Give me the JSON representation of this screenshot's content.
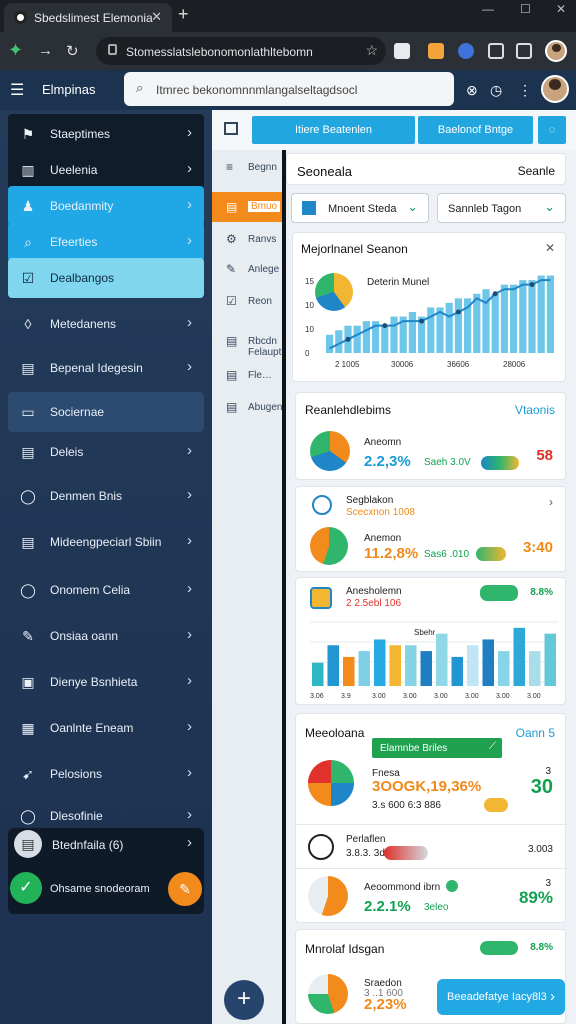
{
  "browser": {
    "tab_title": "Sbedslimest Elemonia",
    "url": "Stomesslatslebonomonlathltebomn",
    "controls": {
      "min": "—",
      "max": "☐",
      "close": "✕"
    }
  },
  "app": {
    "title": "Elmpinas",
    "search": "Itmrec bekonomnnmlangalseltagdsocl"
  },
  "sidebar": {
    "items": [
      {
        "label": "Staeptimes",
        "icon": "flag-icon"
      },
      {
        "label": "Ueelenia",
        "icon": "chart-icon"
      },
      {
        "label": "Boedanmity",
        "icon": "people-icon"
      },
      {
        "label": "Efeerties",
        "icon": "search-icon"
      },
      {
        "label": "Dealbangos",
        "icon": "check-icon"
      },
      {
        "label": "Metedanens",
        "icon": "leaf-icon"
      },
      {
        "label": "Bepenal Idegesin",
        "icon": "doc-icon"
      },
      {
        "label": "Sociernae",
        "icon": "list-icon"
      },
      {
        "label": "Deleis",
        "icon": "doc-icon"
      },
      {
        "label": "Denmen Bnis",
        "icon": "target-icon"
      },
      {
        "label": "Mideengpeciarl Sbiin",
        "icon": "doc-icon"
      },
      {
        "label": "Onomem Celia",
        "icon": "target-icon"
      },
      {
        "label": "Onsiaa oann",
        "icon": "edit-icon"
      },
      {
        "label": "Dienye Bsnhieta",
        "icon": "calendar-icon"
      },
      {
        "label": "Oanlnte Eneam",
        "icon": "grid-icon"
      },
      {
        "label": "Pelosions",
        "icon": "rocket-icon"
      },
      {
        "label": "Dlesofinie",
        "icon": "target-icon"
      },
      {
        "label": "Btednfaila (6)",
        "icon": "doc-icon"
      }
    ],
    "footer": "Ohsame snodeoram"
  },
  "toolbar": {
    "btn1": "Itiere Beatenlen",
    "btn2": "Baelonof Bntge"
  },
  "rail": {
    "items": [
      {
        "label": "Begnn",
        "icon": "menu-icon"
      },
      {
        "label": "Bmuo",
        "icon": "doc-icon"
      },
      {
        "label": "Ranvs",
        "icon": "gear-icon"
      },
      {
        "label": "Anlege",
        "icon": "edit-icon"
      },
      {
        "label": "Reon",
        "icon": "check-icon"
      },
      {
        "label": "Rbcdn\nFelaupt",
        "icon": "doc-icon"
      },
      {
        "label": "Fle…",
        "icon": "doc-icon"
      },
      {
        "label": "Abugen",
        "icon": "doc-icon"
      }
    ]
  },
  "main": {
    "head_left": "Seoneala",
    "head_right": "Seanle",
    "select1": "Mnoent Steda",
    "select2": "Sannleb Tagon",
    "chart_card": {
      "title": "Mejorlnanel Seanon",
      "legend": "Deterin Munel",
      "yticks": [
        "15",
        "10",
        "10",
        "0"
      ],
      "xticks": [
        "2 1005",
        "30006",
        "36606",
        "28006"
      ]
    },
    "sec1": {
      "title": "Reanlehdlebims",
      "link": "Vtaonis"
    },
    "row1": {
      "name": "Aneomn",
      "pct": "2.2,3%",
      "sub": "Saeh 3.0V",
      "val": "58"
    },
    "row2": {
      "name": "Segblakon",
      "sub2": "Scecxnon 1008",
      "name2": "Anemon",
      "pct": "11.2,8%",
      "sub": "Sas6 .010",
      "val": "3:40"
    },
    "chart2": {
      "name": "Anesholemn",
      "sub": "2 2.5ebl 106",
      "badge": "8.8%",
      "top": "Sbehr",
      "xticks": [
        "3.06",
        "3.0",
        "3.9",
        "3.00",
        "3.00",
        "3.00",
        "3.00",
        "3.00",
        "3.00",
        "3.00",
        "3.00",
        "3.00",
        "3.00",
        "3.00",
        "3.00",
        "3.00"
      ]
    },
    "sec2": {
      "title": "Meeoloana",
      "link": "Oann 5",
      "pill": "Elamnbe Briles"
    },
    "row3": {
      "name": "Fnesa",
      "pct": "3OOGK,19,36%",
      "sub": "3.s 600 6:3 886",
      "val": "30",
      "val_top": "3"
    },
    "row4": {
      "name": "Perlaflen",
      "sub": "3.8.3. 3ds",
      "val": "3.003"
    },
    "row5": {
      "name": "Aeoommond ibrn",
      "pct": "2.2.1%",
      "sub": "3eleo",
      "val": "89%",
      "val_top": "3"
    },
    "sec3": {
      "title": "Mnrolaf Idsgan",
      "badge": "8.8%"
    },
    "row6": {
      "name": "Sraedon",
      "pct": "2,23%",
      "sub": "3 ..1 600"
    },
    "toast": "Beeadefatye Iacy8l3"
  },
  "chart_data": {
    "type": "bar",
    "values": [
      4,
      5,
      6,
      6,
      7,
      7,
      6,
      8,
      8,
      9,
      8,
      10,
      10,
      11,
      12,
      12,
      13,
      14,
      13,
      15,
      15,
      16,
      16,
      17,
      17
    ],
    "line": [
      1,
      2,
      3,
      4,
      5,
      6,
      6,
      6,
      7,
      7,
      7,
      8,
      9,
      8,
      9,
      10,
      12,
      11,
      13,
      14,
      14,
      15,
      15,
      16,
      16
    ],
    "ylim": [
      0,
      18
    ],
    "colors": {
      "bar": "#6ec7e8",
      "line": "#1f86c8"
    }
  },
  "chart2_data": {
    "type": "bar",
    "values": [
      4,
      7,
      5,
      6,
      8,
      7,
      7,
      6,
      9,
      5,
      7,
      8,
      6,
      10,
      6,
      9
    ],
    "colors": [
      "#2eb6c4",
      "#2196d3",
      "#f28a1c",
      "#7fd0e6",
      "#27a9e1",
      "#f2b632",
      "#86d3e6",
      "#1f7fc2",
      "#8fd8e8",
      "#2196d3",
      "#bfe6f2",
      "#1f7fc2",
      "#8ad4e8",
      "#2ea8d6",
      "#a9dde9",
      "#63c9d9"
    ],
    "ylim": [
      0,
      11
    ]
  }
}
